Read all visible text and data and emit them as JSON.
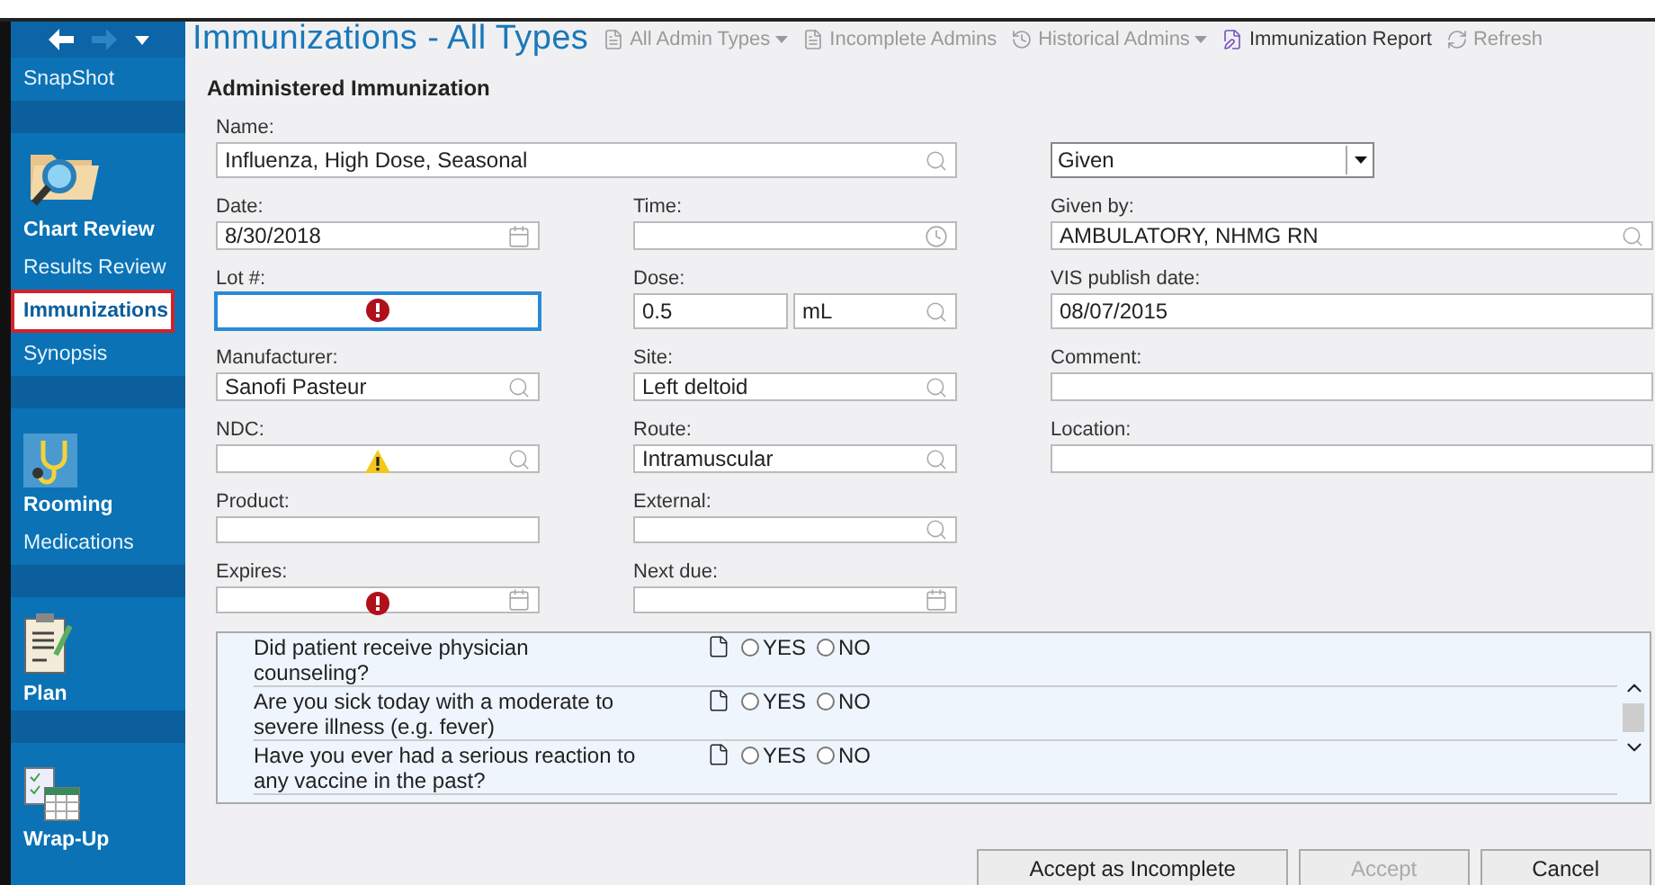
{
  "nav": {
    "items": [
      {
        "kind": "link",
        "label": "SnapShot",
        "selected": false
      },
      {
        "kind": "section",
        "label": "Chart Review",
        "selected": false
      },
      {
        "kind": "link",
        "label": "Results Review",
        "selected": false
      },
      {
        "kind": "link",
        "label": "Immunizations",
        "selected": true
      },
      {
        "kind": "link",
        "label": "Synopsis",
        "selected": false
      },
      {
        "kind": "section",
        "label": "Rooming",
        "selected": false
      },
      {
        "kind": "link",
        "label": "Medications",
        "selected": false
      },
      {
        "kind": "section",
        "label": "Plan",
        "selected": false
      },
      {
        "kind": "section",
        "label": "Wrap-Up",
        "selected": false
      }
    ]
  },
  "header": {
    "title": "Immunizations - All Types",
    "toolbar": [
      {
        "label": "All Admin Types",
        "dropdown": true,
        "disabled": true
      },
      {
        "label": "Incomplete Admins",
        "dropdown": false,
        "disabled": true
      },
      {
        "label": "Historical Admins",
        "dropdown": true,
        "disabled": true
      },
      {
        "label": "Immunization Report",
        "dropdown": false,
        "disabled": false
      },
      {
        "label": "Refresh",
        "dropdown": false,
        "disabled": true
      }
    ]
  },
  "section_title": "Administered Immunization",
  "form_rows": [
    [
      {
        "kind": "lookup",
        "label": "Name:",
        "value": "Influenza, High Dose, Seasonal"
      },
      {
        "kind": "select",
        "value": "Given"
      }
    ],
    [
      {
        "kind": "date",
        "label": "Date:",
        "value": "8/30/2018"
      },
      {
        "kind": "time",
        "label": "Time:"
      },
      {
        "kind": "lookup",
        "label": "Given by:",
        "value": "AMBULATORY, NHMG RN"
      }
    ],
    [
      {
        "kind": "text",
        "label": "Lot #:",
        "error": true,
        "focused": true
      },
      {
        "kind": "dose",
        "label": "Dose:",
        "value": "0.5",
        "unit": "mL"
      },
      {
        "kind": "text",
        "label": "VIS publish date:",
        "value": "08/07/2015"
      }
    ],
    [
      {
        "kind": "lookup",
        "label": "Manufacturer:",
        "value": "Sanofi Pasteur"
      },
      {
        "kind": "lookup",
        "label": "Site:",
        "value": "Left deltoid"
      },
      {
        "kind": "text",
        "label": "Comment:"
      }
    ],
    [
      {
        "kind": "lookup",
        "label": "NDC:",
        "warning": true
      },
      {
        "kind": "lookup",
        "label": "Route:",
        "value": "Intramuscular"
      },
      {
        "kind": "text",
        "label": "Location:"
      }
    ],
    [
      {
        "kind": "text",
        "label": "Product:"
      },
      {
        "kind": "lookup",
        "label": "External:"
      }
    ],
    [
      {
        "kind": "date",
        "label": "Expires:",
        "error": true
      },
      {
        "kind": "date",
        "label": "Next due:"
      }
    ]
  ],
  "questions": [
    {
      "text": "Did patient receive physician counseling?",
      "options": [
        {
          "label": "YES",
          "selected": false
        },
        {
          "label": "NO",
          "selected": false
        }
      ]
    },
    {
      "text": "Are you sick today with a moderate to severe illness (e.g. fever)",
      "options": [
        {
          "label": "YES",
          "selected": false
        },
        {
          "label": "NO",
          "selected": false
        }
      ]
    },
    {
      "text": "Have you ever had a serious reaction to any vaccine in the past?",
      "options": [
        {
          "label": "YES",
          "selected": false
        },
        {
          "label": "NO",
          "selected": false
        }
      ]
    }
  ],
  "buttons": [
    {
      "label": "Accept as Incomplete",
      "disabled": false
    },
    {
      "label": "Accept",
      "disabled": true
    },
    {
      "label": "Cancel",
      "disabled": false
    }
  ]
}
